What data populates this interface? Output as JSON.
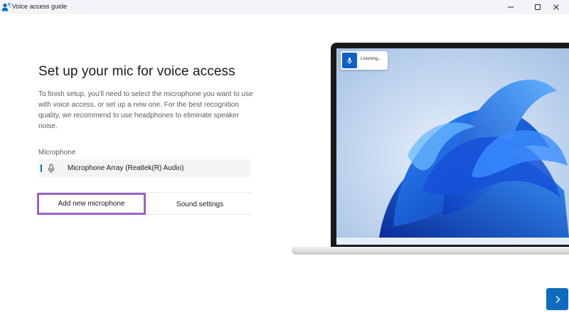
{
  "window": {
    "title": "Voice access guide",
    "icons": {
      "app": "people-icon",
      "minimize": "minimize-icon",
      "maximize": "maximize-icon",
      "close": "close-icon"
    }
  },
  "main": {
    "heading": "Set up your mic for voice access",
    "description": "To finish setup, you'll need to select the microphone you want to use with voice access, or set up a new one. For the best recognition quality, we recommend to use headphones to eliminate speaker noise.",
    "microphone_label": "Microphone",
    "microphone_value": "Microphone Array (Realtek(R) Audio)",
    "add_microphone_label": "Add new microphone",
    "sound_settings_label": "Sound settings"
  },
  "illustration": {
    "listening_text": "Listening..."
  },
  "footer": {
    "next_icon": "chevron-right-icon"
  },
  "colors": {
    "accent": "#0f6cbd",
    "highlight": "#9a63c7",
    "titlebar": "#f3f4f8"
  }
}
